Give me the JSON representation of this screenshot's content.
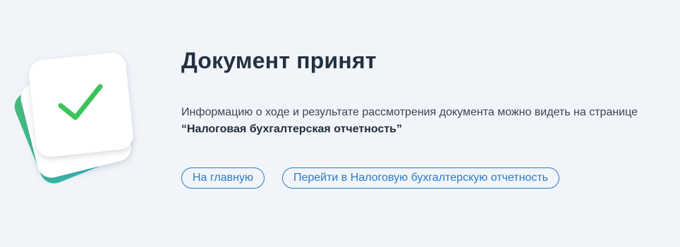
{
  "illustration": {
    "icon": "checkmark-icon",
    "colors": {
      "check": "#3dc35c",
      "stack_front": "#ffffff",
      "stack_green": "#43b97f",
      "stack_teal": "#27b8c4"
    }
  },
  "result": {
    "title": "Документ принят",
    "description": "Информацию о ходе и результате рассмотрения документа можно видеть на странице",
    "page_name": "“Налоговая бухгалтерская отчетность”"
  },
  "actions": {
    "home_label": "На главную",
    "reports_label": "Перейти в Налоговую бухгалтерскую отчетность"
  },
  "colors": {
    "background": "#f1f4f9",
    "accent": "#2a7bc7"
  }
}
